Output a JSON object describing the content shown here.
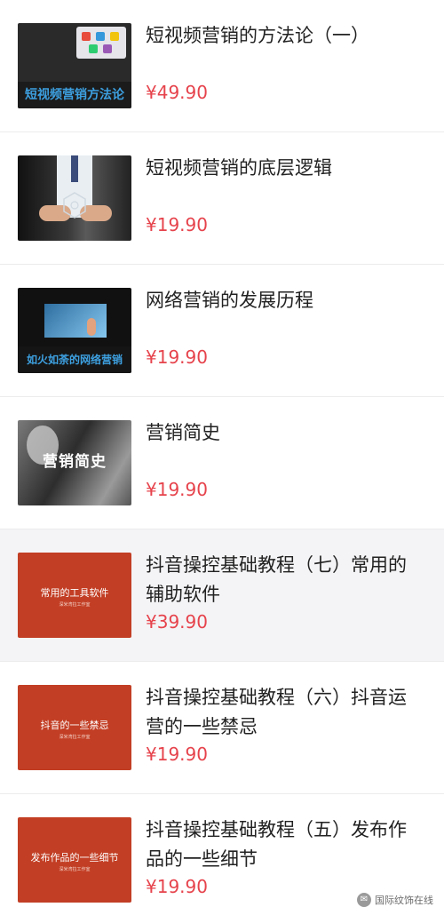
{
  "courses": [
    {
      "title": "短视频营销的方法论（一）",
      "price": "¥49.90",
      "thumb_caption": "短视频营销方法论"
    },
    {
      "title": "短视频营销的底层逻辑",
      "price": "¥19.90"
    },
    {
      "title": "网络营销的发展历程",
      "price": "¥19.90",
      "thumb_caption": "如火如荼的网络营销"
    },
    {
      "title": "营销简史",
      "price": "¥19.90",
      "thumb_caption": "营销简史"
    },
    {
      "title": "抖音操控基础教程（七）常用的辅助软件",
      "price": "¥39.90",
      "thumb_caption": "常用的工具软件",
      "thumb_sub": "深米湾拉工作室"
    },
    {
      "title": "抖音操控基础教程（六）抖音运营的一些禁忌",
      "price": "¥19.90",
      "thumb_caption": "抖音的一些禁忌",
      "thumb_sub": "深米湾拉工作室"
    },
    {
      "title": "抖音操控基础教程（五）发布作品的一些细节",
      "price": "¥19.90",
      "thumb_caption": "发布作品的一些细节",
      "thumb_sub": "深米湾拉工作室"
    }
  ],
  "watermark": {
    "text": "国际纹饰在线",
    "icon": "wechat-icon"
  },
  "colors": {
    "price": "#e6434c",
    "title": "#222222",
    "thumb_red": "#c23e24",
    "highlight_row": "#f4f4f6"
  }
}
